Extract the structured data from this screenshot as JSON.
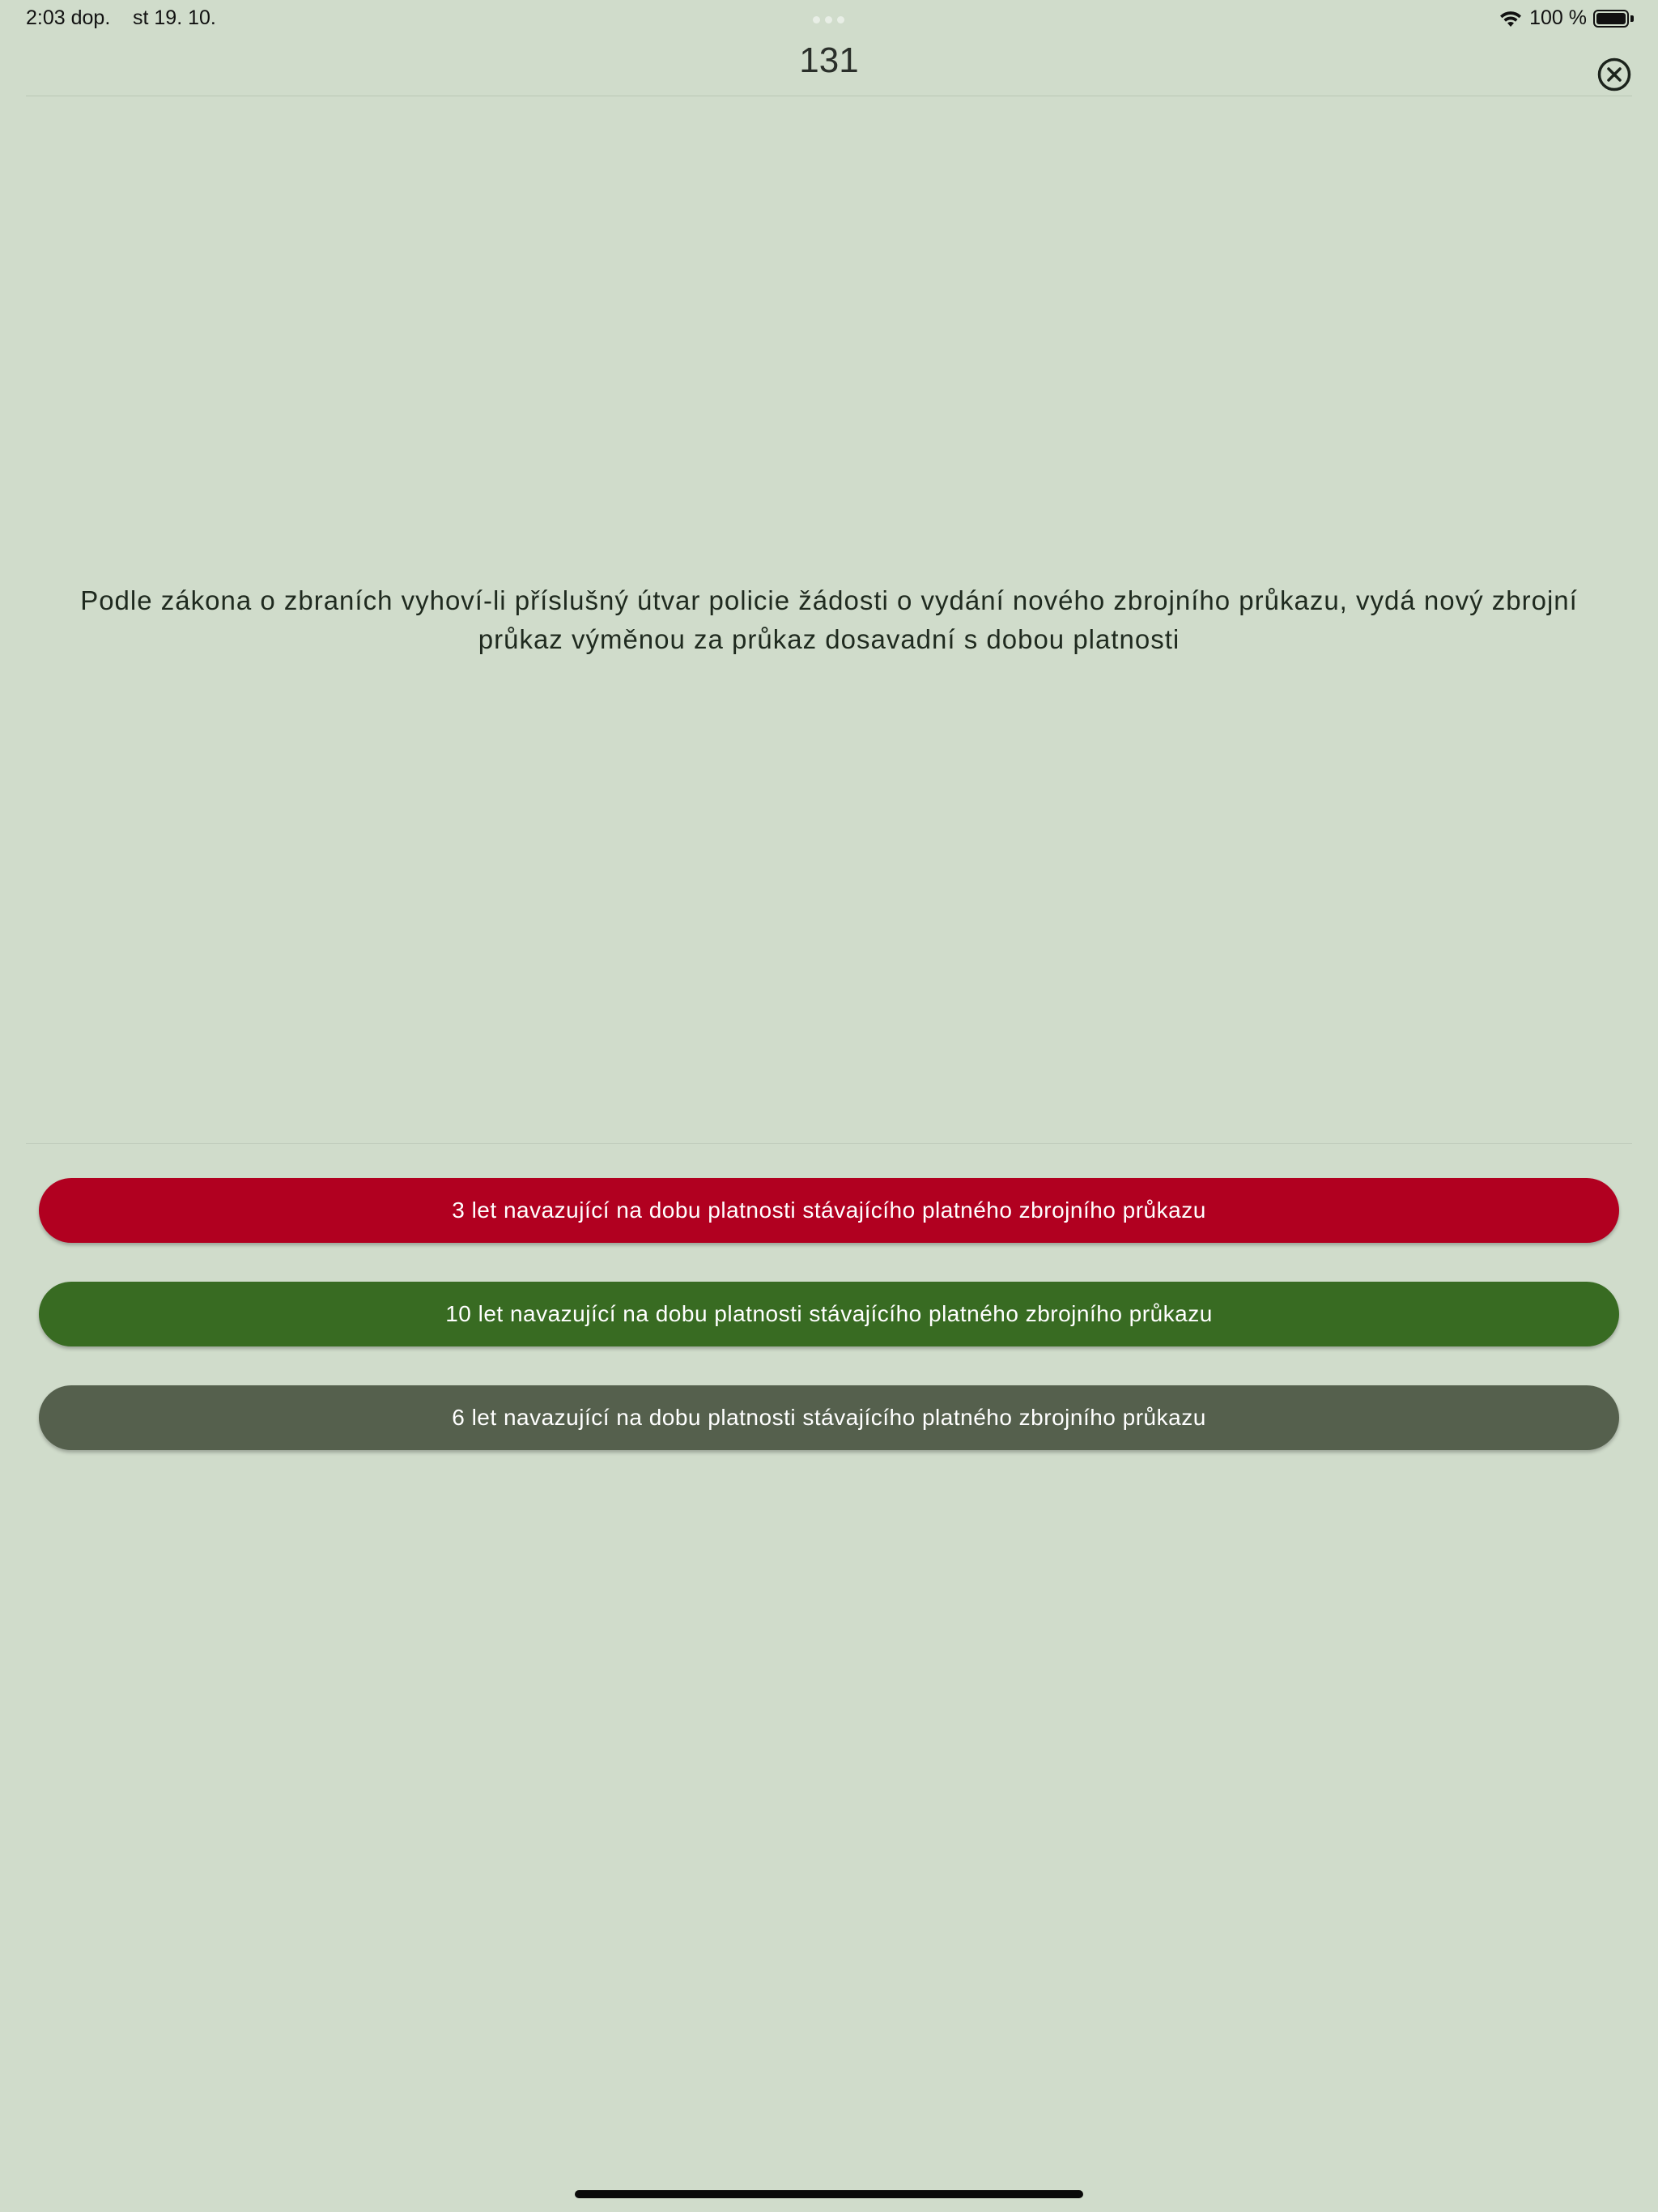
{
  "status_bar": {
    "time": "2:03 dop.",
    "date": "st 19. 10.",
    "battery_percent_label": "100 %",
    "icons": [
      "wifi-icon",
      "battery-icon"
    ]
  },
  "header": {
    "title": "131",
    "close_icon": "close-circle-icon"
  },
  "question": {
    "text": "Podle zákona o zbraních vyhoví-li příslušný útvar policie žádosti o vydání nového zbrojního průkazu, vydá nový zbrojní průkaz výměnou za průkaz dosavadní s dobou platnosti"
  },
  "answers": [
    {
      "label": "3 let navazující na dobu platnosti stávajícího platného zbrojního průkazu",
      "color": "#b10020"
    },
    {
      "label": "10 let navazující na dobu platnosti stávajícího platného zbrojního průkazu",
      "color": "#386b22"
    },
    {
      "label": "6 let navazující na dobu platnosti stávajícího platného zbrojního průkazu",
      "color": "#55604d"
    }
  ],
  "colors": {
    "background": "#d0dccb",
    "wrong": "#b10020",
    "correct": "#386b22",
    "neutral": "#55604d"
  }
}
